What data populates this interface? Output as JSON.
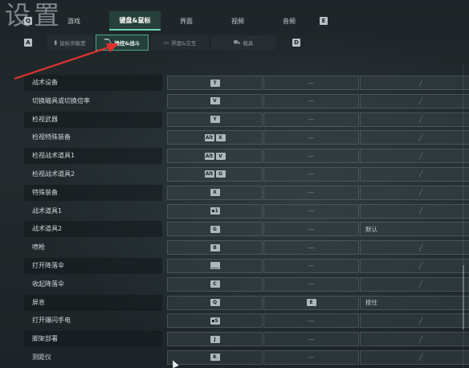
{
  "page_title": "设置",
  "top_tabs": {
    "left_key": "Q",
    "right_key": "E",
    "items": [
      {
        "label": "游戏"
      },
      {
        "label": "键盘&鼠标",
        "active": true
      },
      {
        "label": "界面"
      },
      {
        "label": "视频"
      },
      {
        "label": "音频"
      }
    ]
  },
  "sub_tabs": {
    "left_key": "A",
    "right_key": "D",
    "items": [
      {
        "label": "鼠标灵敏度",
        "icon": "mouse-icon"
      },
      {
        "label": "操控&战斗",
        "icon": "gun-icon",
        "active": true
      },
      {
        "label": "界面&交互",
        "icon": "interface-icon"
      },
      {
        "label": "载具",
        "icon": "vehicle-icon"
      }
    ]
  },
  "colors": {
    "accent": "#6fd3b0",
    "annotation_arrow": "#e0312e"
  },
  "rows": [
    {
      "label": "战术设备",
      "keys": [
        "T"
      ],
      "secondary": "—",
      "third": "pencil"
    },
    {
      "label": "切换瞄具或切换倍率",
      "keys": [
        "V"
      ],
      "secondary": "—",
      "third": "pencil"
    },
    {
      "label": "检视武器",
      "keys": [
        "Y"
      ],
      "secondary": "—",
      "third": "pencil"
    },
    {
      "label": "检视特殊装备",
      "keys": [
        "Alt",
        "X"
      ],
      "secondary": "—",
      "third": "pencil"
    },
    {
      "label": "检视战术道具1",
      "keys": [
        "Alt",
        "V"
      ],
      "secondary": "—",
      "third": "pencil"
    },
    {
      "label": "检视战术道具2",
      "keys": [
        "Alt",
        "G"
      ],
      "secondary": "—",
      "third": "pencil"
    },
    {
      "label": "特殊装备",
      "keys": [
        "X"
      ],
      "secondary": "—",
      "third": "pencil"
    },
    {
      "label": "战术道具1",
      "keys": [
        "▪1"
      ],
      "secondary": "—",
      "third": "pencil"
    },
    {
      "label": "战术道具2",
      "keys": [
        "G"
      ],
      "secondary": "—",
      "third": "dropdown",
      "third_value": "默认"
    },
    {
      "label": "喷枪",
      "keys": [
        "B"
      ],
      "secondary": "—",
      "third": "pencil"
    },
    {
      "label": "打开降落伞",
      "keys": [
        "___"
      ],
      "secondary": "—",
      "third": "pencil"
    },
    {
      "label": "收起降落伞",
      "keys": [
        "C"
      ],
      "secondary": "—",
      "third": "pencil"
    },
    {
      "label": "屏息",
      "keys": [
        "Q"
      ],
      "secondary_key": "E",
      "third": "dropdown",
      "third_value": "按住"
    },
    {
      "label": "打开爆闪手电",
      "keys": [
        "▪5"
      ],
      "secondary": "—",
      "third": "pencil"
    },
    {
      "label": "脚架部署",
      "keys": [
        "J"
      ],
      "secondary": "—",
      "third": "pencil"
    },
    {
      "label": "测距仪",
      "keys": [
        "K"
      ],
      "secondary": "—",
      "third": "pencil"
    }
  ]
}
